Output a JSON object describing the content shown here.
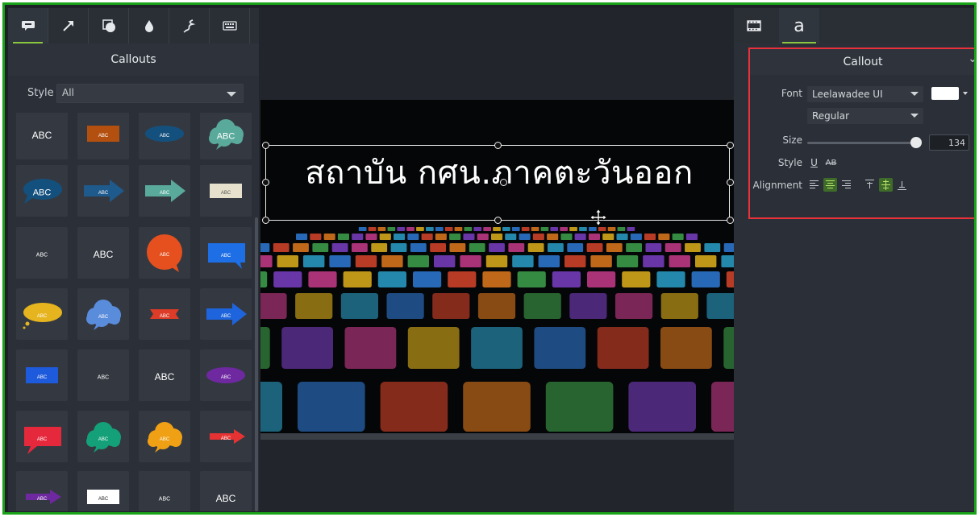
{
  "left_panel": {
    "tool_tabs": [
      {
        "name": "callouts-tab-icon",
        "active": true
      },
      {
        "name": "arrow-tool-icon",
        "active": false
      },
      {
        "name": "shape-tool-icon",
        "active": false
      },
      {
        "name": "drop-tool-icon",
        "active": false
      },
      {
        "name": "sketch-motion-icon",
        "active": false
      },
      {
        "name": "keystroke-callout-icon",
        "active": false
      }
    ],
    "title": "Callouts",
    "style_label": "Style",
    "style_value": "All",
    "tiles": [
      {
        "shape": "text",
        "label": "ABC",
        "color": "#ffffff"
      },
      {
        "shape": "rect",
        "label": "ABC",
        "color": "#b4500f"
      },
      {
        "shape": "oval",
        "label": "ABC",
        "color": "#14507d"
      },
      {
        "shape": "cloud",
        "label": "ABC",
        "color": "#5aaa9b"
      },
      {
        "shape": "speech-oval",
        "label": "ABC",
        "color": "#14507d"
      },
      {
        "shape": "arrow",
        "label": "ABC",
        "color": "#1e5a8c"
      },
      {
        "shape": "arrow",
        "label": "ABC",
        "color": "#5aaa9b"
      },
      {
        "shape": "note",
        "label": "ABC",
        "color": "#e6e1cd"
      },
      {
        "shape": "text-small",
        "label": "ABC",
        "color": "#ffffff"
      },
      {
        "shape": "text",
        "label": "ABC",
        "color": "#ffffff"
      },
      {
        "shape": "circle-speech",
        "label": "ABC",
        "color": "#e6501e"
      },
      {
        "shape": "speech-rect",
        "label": "ABC",
        "color": "#1e6ee6"
      },
      {
        "shape": "thought-oval",
        "label": "ABC",
        "color": "#e6b41e"
      },
      {
        "shape": "cloud",
        "label": "ABC",
        "color": "#5a8cdc"
      },
      {
        "shape": "ribbon",
        "label": "ABC",
        "color": "#dc3c28"
      },
      {
        "shape": "arrow",
        "label": "ABC",
        "color": "#1e64dc"
      },
      {
        "shape": "rect",
        "label": "ABC",
        "color": "#1e5adc"
      },
      {
        "shape": "text-small",
        "label": "ABC",
        "color": "#ffffff"
      },
      {
        "shape": "text",
        "label": "ABC",
        "color": "#ffffff"
      },
      {
        "shape": "oval",
        "label": "ABC",
        "color": "#6e28a0"
      },
      {
        "shape": "speech-rect",
        "label": "ABC",
        "color": "#e6283c"
      },
      {
        "shape": "cloud",
        "label": "ABC",
        "color": "#14a078"
      },
      {
        "shape": "cloud",
        "label": "ABC",
        "color": "#f0a014"
      },
      {
        "shape": "arrow",
        "label": "ABC",
        "color": "#e63232"
      },
      {
        "shape": "arrow",
        "label": "ABC",
        "color": "#6e28a0"
      },
      {
        "shape": "plain-rect",
        "label": "ABC",
        "color": "#ffffff"
      },
      {
        "shape": "text-small",
        "label": "ABC",
        "color": "#ffffff"
      },
      {
        "shape": "text",
        "label": "ABC",
        "color": "#ffffff"
      }
    ]
  },
  "canvas": {
    "callout_text": "สถาบัน กศน.ภาคตะวันออก"
  },
  "right_panel": {
    "tabs": [
      {
        "name": "filmstrip-icon",
        "active": false
      },
      {
        "name": "text-properties-icon",
        "label": "a",
        "active": true
      }
    ],
    "title": "Callout",
    "font_label": "Font",
    "font_value": "Leelawadee UI",
    "font_color": "#ffffff",
    "weight_value": "Regular",
    "size_label": "Size",
    "size_value": "134",
    "size_fraction": 0.98,
    "style_label": "Style",
    "alignment_label": "Alignment",
    "horizontal_alignment": "center",
    "vertical_alignment": "middle",
    "accent": "#8cc63f",
    "highlight_border": "#e8313a"
  }
}
